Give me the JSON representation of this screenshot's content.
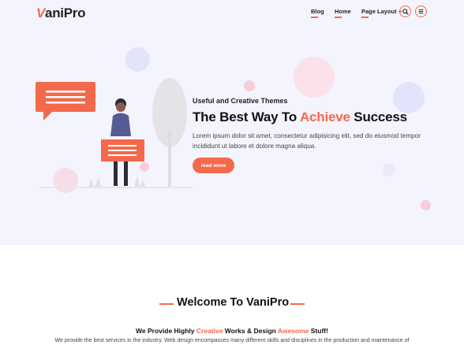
{
  "brand": {
    "logo_first": "V",
    "logo_rest": "aniPro"
  },
  "nav": {
    "items": [
      {
        "label": "Blog"
      },
      {
        "label": "Home"
      },
      {
        "label": "Page Layout +"
      }
    ],
    "search_icon": "search-icon",
    "menu_icon": "hamburger-icon"
  },
  "hero": {
    "subtitle": "Useful and Creative Themes",
    "title_before": "The Best Way To ",
    "title_accent": "Achieve",
    "title_after": " Success",
    "text": "Lorem ipsum dolor sit amet, consectetur adipisicing elit, sed do eiusmod tempor incididunt ut labore et dolore magna aliqua.",
    "button_label": "read more"
  },
  "welcome": {
    "title": "Welcome To VaniPro",
    "tagline_1": "We Provide Highly ",
    "tagline_accent_1": "Creative",
    "tagline_2": " Works & Design ",
    "tagline_accent_2": "Awesome",
    "tagline_3": " Stuff!",
    "description": "We provide the best services in the industry. Web design encompasses many different skills and disciplines in the production and maintenance of"
  },
  "colors": {
    "accent": "#f26a4b",
    "hero_bg": "#f4f4ff",
    "bubble_pink": "#fbe1ea",
    "bubble_lavender": "#e3e4fb"
  }
}
